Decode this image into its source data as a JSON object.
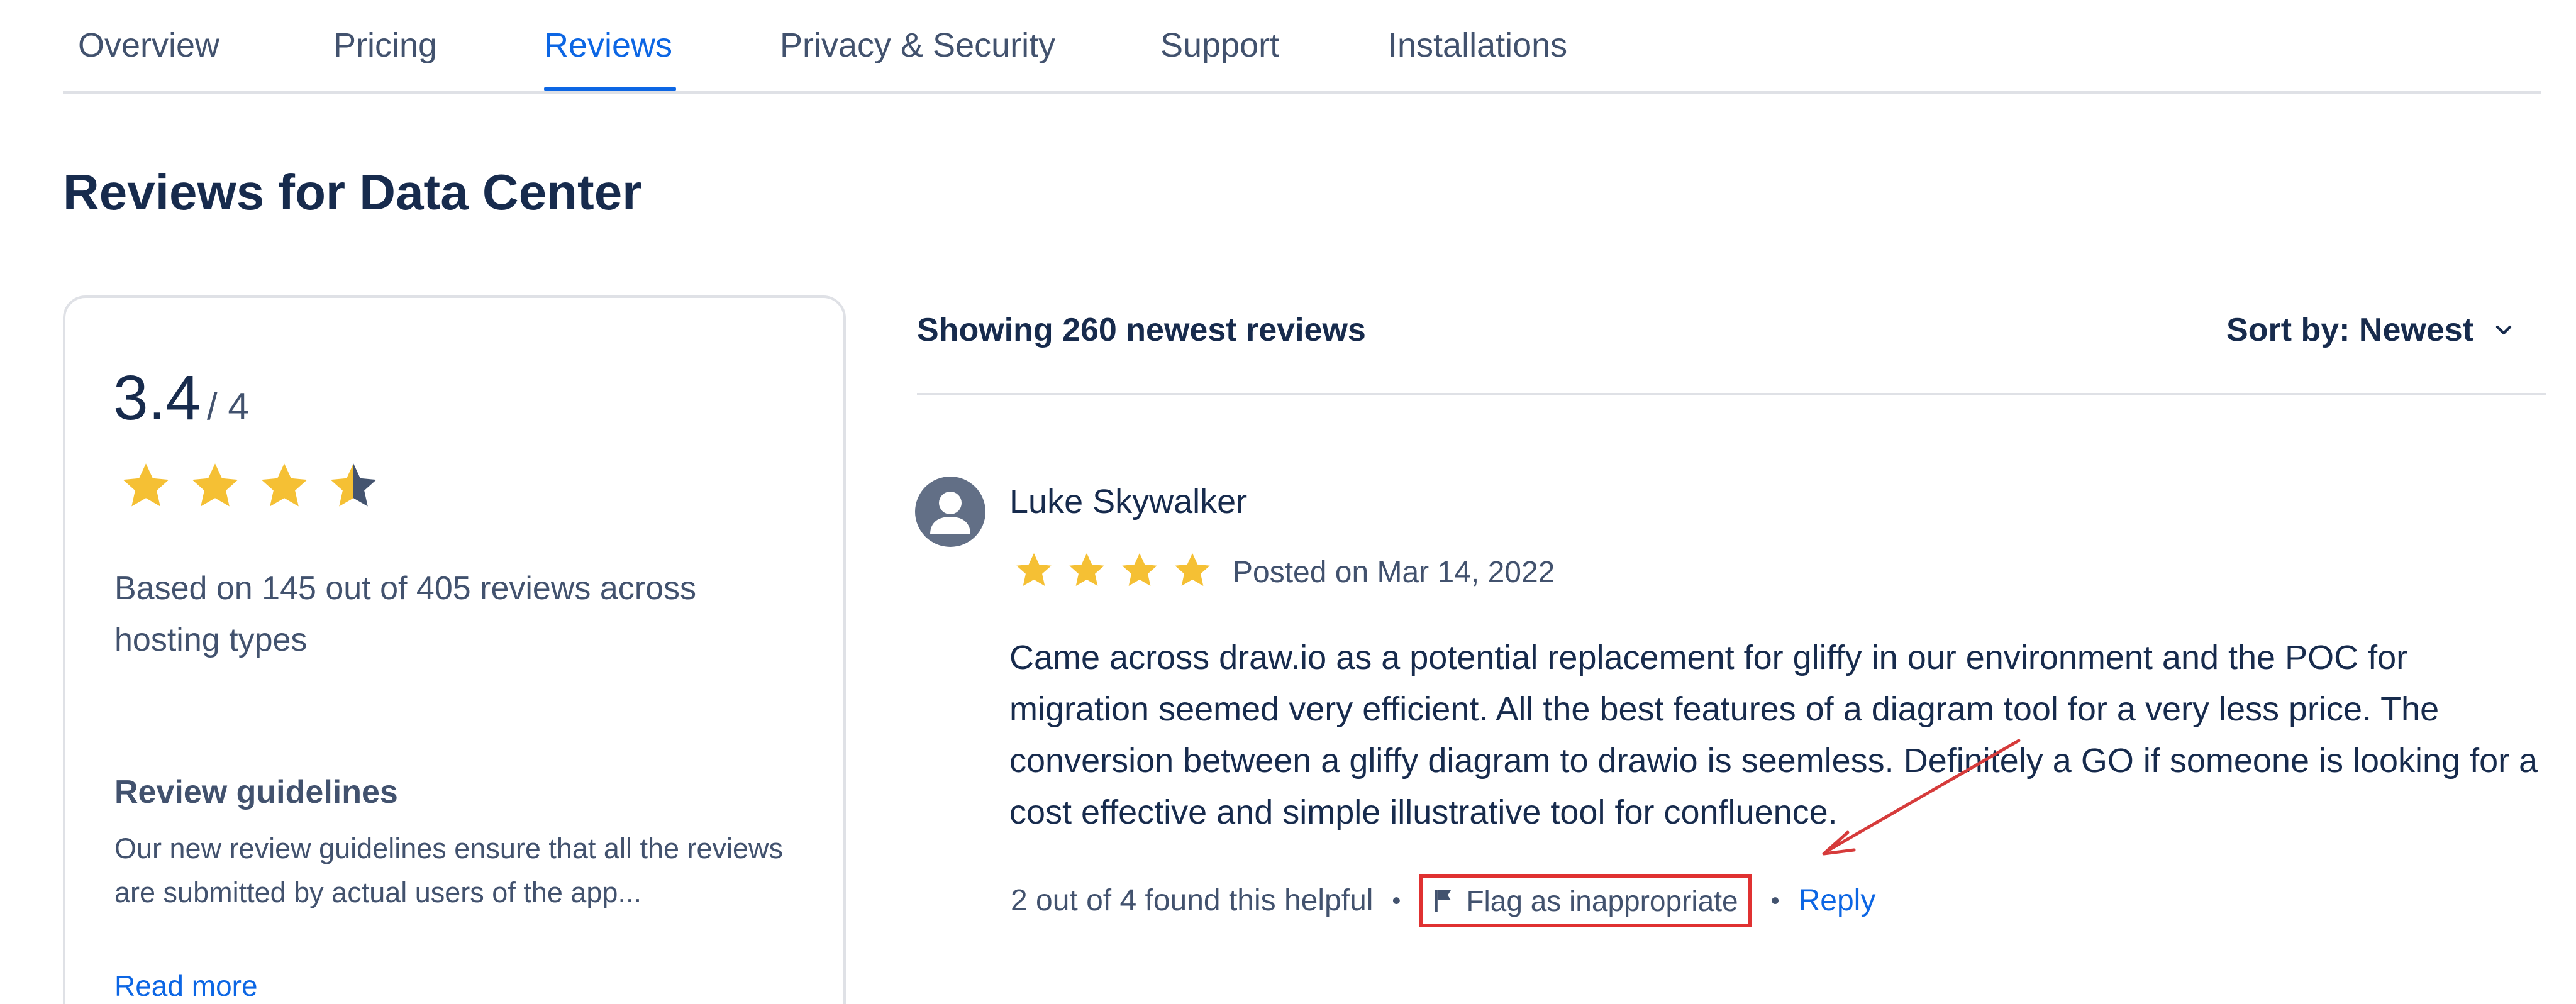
{
  "tabs": [
    {
      "label": "Overview"
    },
    {
      "label": "Pricing"
    },
    {
      "label": "Reviews",
      "active": true
    },
    {
      "label": "Privacy & Security"
    },
    {
      "label": "Support"
    },
    {
      "label": "Installations"
    }
  ],
  "page_title": "Reviews for Data Center",
  "summary": {
    "rating": "3.4",
    "out_of": "/ 4",
    "stars_filled": 3.5,
    "stars_total": 4,
    "basis": "Based on 145 out of 405 reviews across hosting types",
    "guidelines_title": "Review guidelines",
    "guidelines_text": "Our new review guidelines ensure that all the reviews are submitted by actual users of the app...",
    "read_more": "Read more"
  },
  "reviews_header": {
    "showing": "Showing 260 newest reviews",
    "sort_label": "Sort by: Newest"
  },
  "review": {
    "author": "Luke Skywalker",
    "stars": 4,
    "posted": "Posted on Mar 14, 2022",
    "body": "Came across draw.io as a potential replacement for gliffy in our environment and the POC for migration seemed very efficient. All the best features of a diagram tool for a very less price. The conversion between a gliffy diagram to drawio is seemless. Definitely a GO if someone is looking for a cost effective and simple illustrative tool for confluence.",
    "helpful": "2 out of 4 found this helpful",
    "flag_label": "Flag as inappropriate",
    "reply_label": "Reply",
    "separator": "•"
  },
  "colors": {
    "star": "#f5c034",
    "star_empty": "#44546f",
    "link": "#0c66e4",
    "highlight": "#e03131",
    "text": "#172b4d",
    "muted": "#42526e"
  },
  "icons": {
    "star": "star-icon",
    "half_star": "half-star-icon",
    "avatar": "user-avatar-icon",
    "flag": "flag-icon",
    "chevron": "chevron-down-icon"
  }
}
